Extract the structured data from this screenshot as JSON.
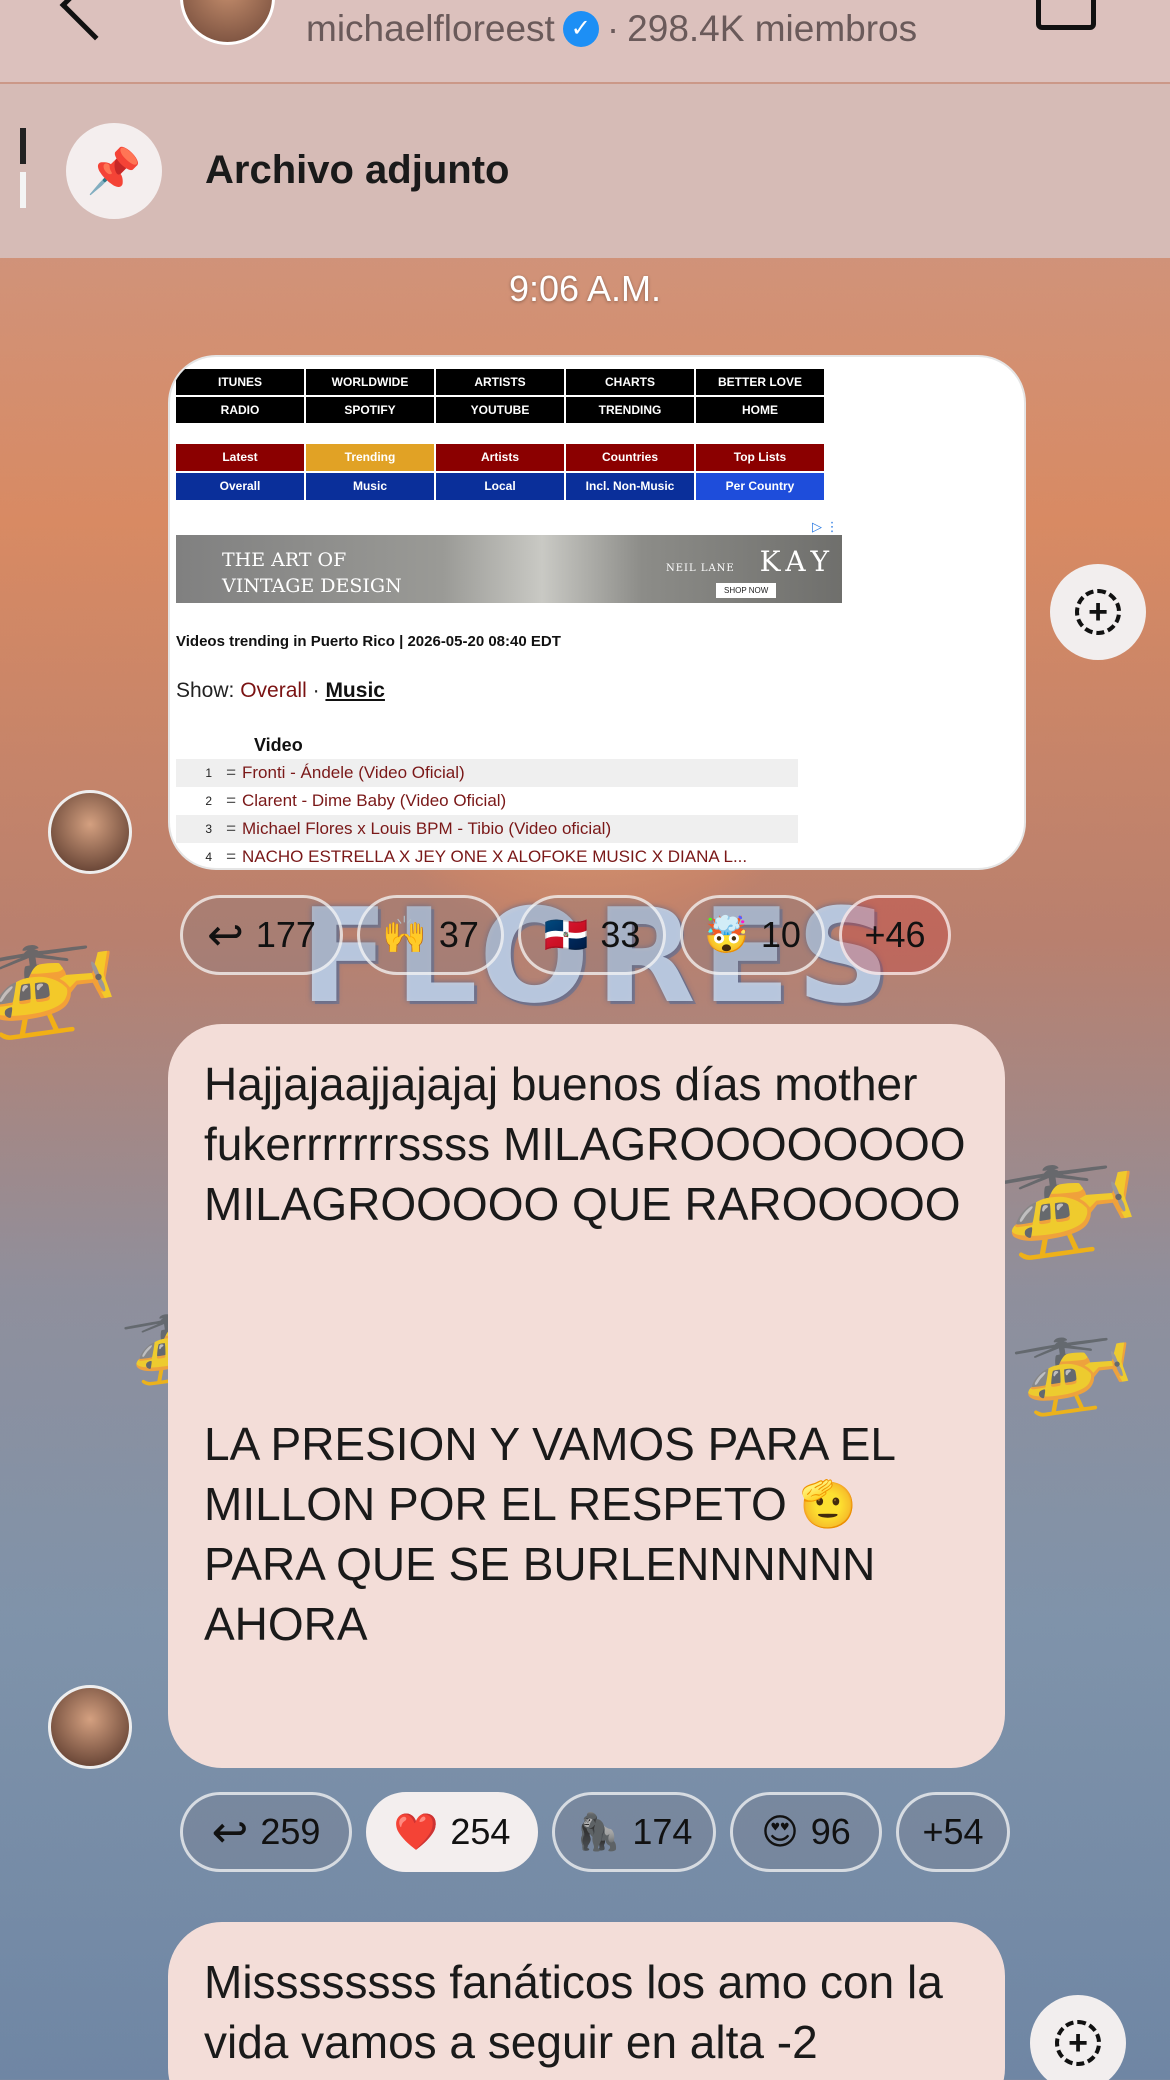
{
  "header": {
    "channel_handle": "michaelfloreest",
    "separator": "·",
    "members": "298.4K miembros"
  },
  "pinned": {
    "label": "Archivo adjunto"
  },
  "timestamp": "9:06 A.M.",
  "image_post": {
    "nav_row1": [
      "ITUNES",
      "WORLDWIDE",
      "ARTISTS",
      "CHARTS",
      "BETTER LOVE"
    ],
    "nav_row2": [
      "RADIO",
      "SPOTIFY",
      "YOUTUBE",
      "TRENDING",
      "HOME"
    ],
    "cat_row1": [
      "Latest",
      "Trending",
      "Artists",
      "Countries",
      "Top Lists"
    ],
    "cat_row2": [
      "Overall",
      "Music",
      "Local",
      "Incl. Non-Music",
      "Per Country"
    ],
    "ad_line1": "THE ART OF",
    "ad_line2": "VINTAGE DESIGN",
    "ad_brand_small": "NEIL LANE",
    "ad_brand": "KAY",
    "ad_cta": "SHOP NOW",
    "title": "Videos trending in Puerto Rico | 2026-05-20 08:40 EDT",
    "show_label": "Show:",
    "show_overall": "Overall",
    "show_dot": "·",
    "show_music": "Music",
    "video_header": "Video",
    "videos": [
      {
        "n": "1",
        "mark": "=",
        "title": "Fronti - Ándele (Video Oficial)"
      },
      {
        "n": "2",
        "mark": "=",
        "title": "Clarent - Dime Baby (Video Oficial)"
      },
      {
        "n": "3",
        "mark": "=",
        "title": "Michael Flores x Louis BPM - Tibio (Video oficial)"
      },
      {
        "n": "4",
        "mark": "=",
        "title": "NACHO ESTRELLA X JEY ONE X ALOFOKE MUSIC X DIANA L..."
      }
    ]
  },
  "reactions1": {
    "replies": "177",
    "r1_emoji": "🙌",
    "r1_count": "37",
    "r2_emoji": "🇩🇴",
    "r2_count": "33",
    "r3_emoji": "🤯",
    "r3_count": "10",
    "more": "+46"
  },
  "message1": {
    "text": "Hajjajaajjajajaj buenos días mother fukerrrrrrrssss MILAGROOOOOOOO MILAGROOOOO QUE RAROOOOO\n\n\n\nLA PRESION Y VAMOS PARA EL MILLON POR EL RESPETO 🫡 PARA QUE SE BURLENNNNNN AHORA"
  },
  "reactions2": {
    "replies": "259",
    "r1_emoji": "❤️",
    "r1_count": "254",
    "r2_emoji": "🦍",
    "r2_count": "174",
    "r3_emoji": "😍",
    "r3_count": "96",
    "more": "+54"
  },
  "message2": {
    "text": "Missssssss fanáticos los amo con la vida vamos a seguir en alta -2"
  },
  "background": {
    "logo_text": "FLORES"
  },
  "colors": {
    "bubble": "#f3ddd8",
    "verified": "#1d8ff5",
    "link_red": "#7a1818"
  }
}
